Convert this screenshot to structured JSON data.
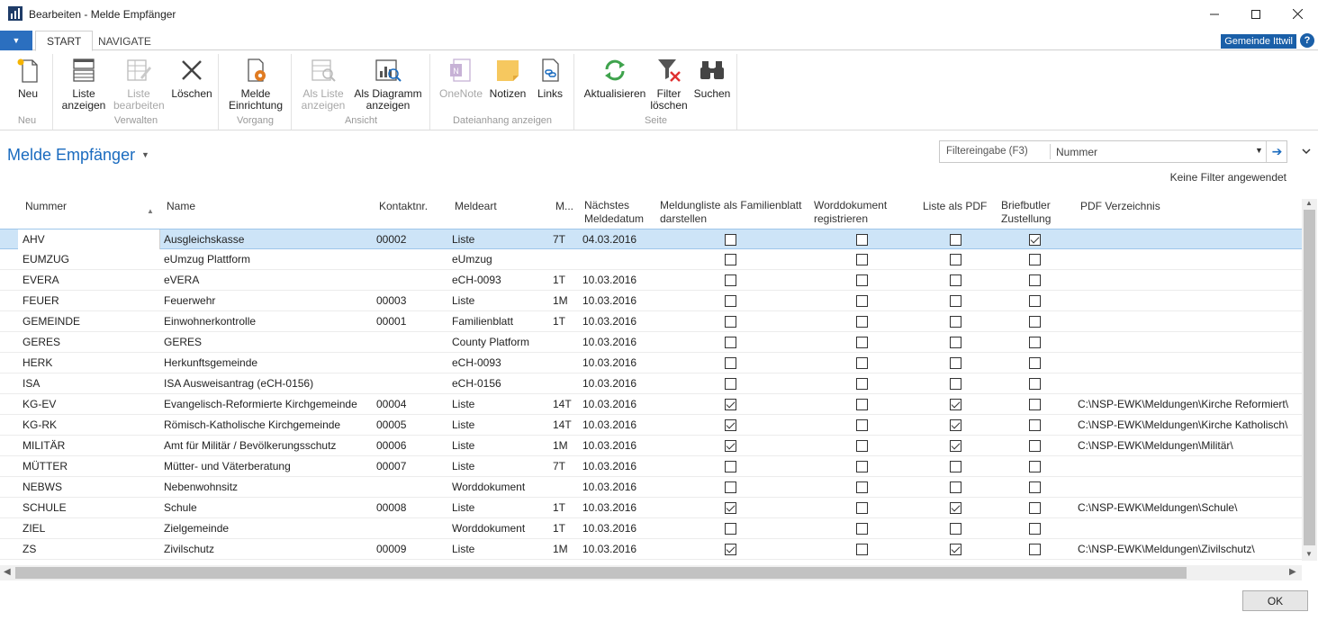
{
  "window": {
    "title": "Bearbeiten - Melde Empfänger"
  },
  "tabs": [
    {
      "label": "START",
      "active": true
    },
    {
      "label": "NAVIGATE",
      "active": false
    }
  ],
  "company": "Gemeinde Ittwil",
  "ribbon": {
    "groups": [
      {
        "label": "Neu",
        "buttons": [
          {
            "label": "Neu",
            "icon": "new-document-icon",
            "disabled": false
          }
        ]
      },
      {
        "label": "Verwalten",
        "buttons": [
          {
            "label": "Liste anzeigen",
            "icon": "view-list-icon",
            "disabled": false
          },
          {
            "label": "Liste bearbeiten",
            "icon": "edit-list-icon",
            "disabled": true
          },
          {
            "label": "Löschen",
            "icon": "delete-icon",
            "disabled": false
          }
        ]
      },
      {
        "label": "Vorgang",
        "buttons": [
          {
            "label": "Melde Einrichtung",
            "icon": "setup-gear-icon",
            "disabled": false
          }
        ]
      },
      {
        "label": "Ansicht",
        "buttons": [
          {
            "label": "Als Liste anzeigen",
            "icon": "show-as-list-icon",
            "disabled": true
          },
          {
            "label": "Als Diagramm anzeigen",
            "icon": "show-as-chart-icon",
            "disabled": false
          }
        ]
      },
      {
        "label": "Dateianhang anzeigen",
        "buttons": [
          {
            "label": "OneNote",
            "icon": "onenote-icon",
            "disabled": true
          },
          {
            "label": "Notizen",
            "icon": "notes-icon",
            "disabled": false
          },
          {
            "label": "Links",
            "icon": "links-icon",
            "disabled": false
          }
        ]
      },
      {
        "label": "Seite",
        "buttons": [
          {
            "label": "Aktualisieren",
            "icon": "refresh-icon",
            "disabled": false
          },
          {
            "label": "Filter löschen",
            "icon": "clear-filter-icon",
            "disabled": false
          },
          {
            "label": "Suchen",
            "icon": "binoculars-icon",
            "disabled": false
          }
        ]
      }
    ]
  },
  "page": {
    "title": "Melde Empfänger",
    "filter_label": "Filtereingabe (F3)",
    "filter_field": "Nummer",
    "no_filter_text": "Keine Filter angewendet"
  },
  "columns": {
    "nummer": "Nummer",
    "name": "Name",
    "kontakt": "Kontaktnr.",
    "meldeart": "Meldeart",
    "m": "M...",
    "datum": "Nächstes Meldedatum",
    "familienblatt": "Meldungliste als Familienblatt darstellen",
    "word": "Worddokument registrieren",
    "pdf": "Liste als PDF",
    "brief": "Briefbutler Zustellung",
    "pdfdir": "PDF Verzeichnis"
  },
  "rows": [
    {
      "nummer": "AHV",
      "name": "Ausgleichskasse",
      "kontakt": "00002",
      "meldeart": "Liste",
      "m": "7T",
      "datum": "04.03.2016",
      "familienblatt": false,
      "word": false,
      "pdf": false,
      "brief": true,
      "pdfdir": "",
      "selected": true
    },
    {
      "nummer": "EUMZUG",
      "name": "eUmzug Plattform",
      "kontakt": "",
      "meldeart": "eUmzug",
      "m": "",
      "datum": "",
      "familienblatt": false,
      "word": false,
      "pdf": false,
      "brief": false,
      "pdfdir": ""
    },
    {
      "nummer": "EVERA",
      "name": "eVERA",
      "kontakt": "",
      "meldeart": "eCH-0093",
      "m": "1T",
      "datum": "10.03.2016",
      "familienblatt": false,
      "word": false,
      "pdf": false,
      "brief": false,
      "pdfdir": ""
    },
    {
      "nummer": "FEUER",
      "name": "Feuerwehr",
      "kontakt": "00003",
      "meldeart": "Liste",
      "m": "1M",
      "datum": "10.03.2016",
      "familienblatt": false,
      "word": false,
      "pdf": false,
      "brief": false,
      "pdfdir": ""
    },
    {
      "nummer": "GEMEINDE",
      "name": "Einwohnerkontrolle",
      "kontakt": "00001",
      "meldeart": "Familienblatt",
      "m": "1T",
      "datum": "10.03.2016",
      "familienblatt": false,
      "word": false,
      "pdf": false,
      "brief": false,
      "pdfdir": ""
    },
    {
      "nummer": "GERES",
      "name": "GERES",
      "kontakt": "",
      "meldeart": "County Platform",
      "m": "",
      "datum": "10.03.2016",
      "familienblatt": false,
      "word": false,
      "pdf": false,
      "brief": false,
      "pdfdir": ""
    },
    {
      "nummer": "HERK",
      "name": "Herkunftsgemeinde",
      "kontakt": "",
      "meldeart": "eCH-0093",
      "m": "",
      "datum": "10.03.2016",
      "familienblatt": false,
      "word": false,
      "pdf": false,
      "brief": false,
      "pdfdir": ""
    },
    {
      "nummer": "ISA",
      "name": "ISA Ausweisantrag (eCH-0156)",
      "kontakt": "",
      "meldeart": "eCH-0156",
      "m": "",
      "datum": "10.03.2016",
      "familienblatt": false,
      "word": false,
      "pdf": false,
      "brief": false,
      "pdfdir": ""
    },
    {
      "nummer": "KG-EV",
      "name": "Evangelisch-Reformierte Kirchgemeinde",
      "kontakt": "00004",
      "meldeart": "Liste",
      "m": "14T",
      "datum": "10.03.2016",
      "familienblatt": true,
      "word": false,
      "pdf": true,
      "brief": false,
      "pdfdir": "C:\\NSP-EWK\\Meldungen\\Kirche Reformiert\\"
    },
    {
      "nummer": "KG-RK",
      "name": "Römisch-Katholische Kirchgemeinde",
      "kontakt": "00005",
      "meldeart": "Liste",
      "m": "14T",
      "datum": "10.03.2016",
      "familienblatt": true,
      "word": false,
      "pdf": true,
      "brief": false,
      "pdfdir": "C:\\NSP-EWK\\Meldungen\\Kirche Katholisch\\"
    },
    {
      "nummer": "MILITÄR",
      "name": "Amt für Militär / Bevölkerungsschutz",
      "kontakt": "00006",
      "meldeart": "Liste",
      "m": "1M",
      "datum": "10.03.2016",
      "familienblatt": true,
      "word": false,
      "pdf": true,
      "brief": false,
      "pdfdir": "C:\\NSP-EWK\\Meldungen\\Militär\\"
    },
    {
      "nummer": "MÜTTER",
      "name": "Mütter- und Väterberatung",
      "kontakt": "00007",
      "meldeart": "Liste",
      "m": "7T",
      "datum": "10.03.2016",
      "familienblatt": false,
      "word": false,
      "pdf": false,
      "brief": false,
      "pdfdir": ""
    },
    {
      "nummer": "NEBWS",
      "name": "Nebenwohnsitz",
      "kontakt": "",
      "meldeart": "Worddokument",
      "m": "",
      "datum": "10.03.2016",
      "familienblatt": false,
      "word": false,
      "pdf": false,
      "brief": false,
      "pdfdir": ""
    },
    {
      "nummer": "SCHULE",
      "name": "Schule",
      "kontakt": "00008",
      "meldeart": "Liste",
      "m": "1T",
      "datum": "10.03.2016",
      "familienblatt": true,
      "word": false,
      "pdf": true,
      "brief": false,
      "pdfdir": "C:\\NSP-EWK\\Meldungen\\Schule\\"
    },
    {
      "nummer": "ZIEL",
      "name": "Zielgemeinde",
      "kontakt": "",
      "meldeart": "Worddokument",
      "m": "1T",
      "datum": "10.03.2016",
      "familienblatt": false,
      "word": false,
      "pdf": false,
      "brief": false,
      "pdfdir": ""
    },
    {
      "nummer": "ZS",
      "name": "Zivilschutz",
      "kontakt": "00009",
      "meldeart": "Liste",
      "m": "1M",
      "datum": "10.03.2016",
      "familienblatt": true,
      "word": false,
      "pdf": true,
      "brief": false,
      "pdfdir": "C:\\NSP-EWK\\Meldungen\\Zivilschutz\\"
    }
  ],
  "footer": {
    "ok_label": "OK"
  },
  "colors": {
    "accent": "#1a6bbf",
    "selection": "#cde4f7",
    "app_menu": "#2b6fbf"
  }
}
